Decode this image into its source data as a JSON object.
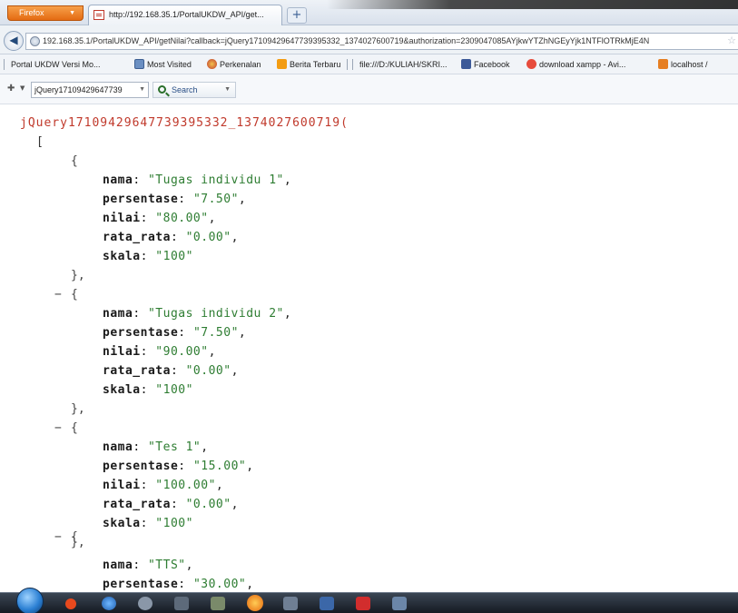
{
  "browser": {
    "menu_button": "Firefox",
    "tab_title": "http://192.168.35.1/PortalUKDW_API/get...",
    "url": "192.168.35.1/PortalUKDW_API/getNilai?callback=jQuery17109429647739395332_1374027600719&authorization=2309047085AYjkwYTZhNGEyYjk1NTFlOTRkMjE4N"
  },
  "bookmarks": [
    {
      "label": "Portal UKDW Versi Mo...",
      "icon": "page-icon"
    },
    {
      "label": "Most Visited",
      "icon": "most-visited-icon"
    },
    {
      "label": "Perkenalan",
      "icon": "globe-icon"
    },
    {
      "label": "Berita Terbaru",
      "icon": "rss-icon"
    },
    {
      "label": "file:///D:/KULIAH/SKRI...",
      "icon": "page-icon"
    },
    {
      "label": "Facebook",
      "icon": "facebook-icon"
    },
    {
      "label": "download xampp - Avi...",
      "icon": "search-result-icon"
    },
    {
      "label": "localhost /",
      "icon": "xampp-icon"
    }
  ],
  "toolbar": {
    "search_field": "jQuery17109429647739",
    "search_button": "Search"
  },
  "json_view": {
    "callback": "jQuery17109429647739395332_1374027600719(",
    "open_bracket": "[",
    "collapse_symbol": "−",
    "items": [
      {
        "nama": "\"Tugas individu 1\"",
        "persentase": "\"7.50\"",
        "nilai": "\"80.00\"",
        "rata_rata": "\"0.00\"",
        "skala": "\"100\""
      },
      {
        "nama": "\"Tugas individu 2\"",
        "persentase": "\"7.50\"",
        "nilai": "\"90.00\"",
        "rata_rata": "\"0.00\"",
        "skala": "\"100\""
      },
      {
        "nama": "\"Tes 1\"",
        "persentase": "\"15.00\"",
        "nilai": "\"100.00\"",
        "rata_rata": "\"0.00\"",
        "skala": "\"100\""
      },
      {
        "nama": "\"TTS\"",
        "persentase": "\"30.00\""
      }
    ],
    "keys": {
      "nama": "nama",
      "persentase": "persentase",
      "nilai": "nilai",
      "rata_rata": "rata_rata",
      "skala": "skala"
    }
  },
  "colors": {
    "callback": "#c0392b",
    "string_value": "#2e7d32",
    "key": "#1a1a1a"
  }
}
